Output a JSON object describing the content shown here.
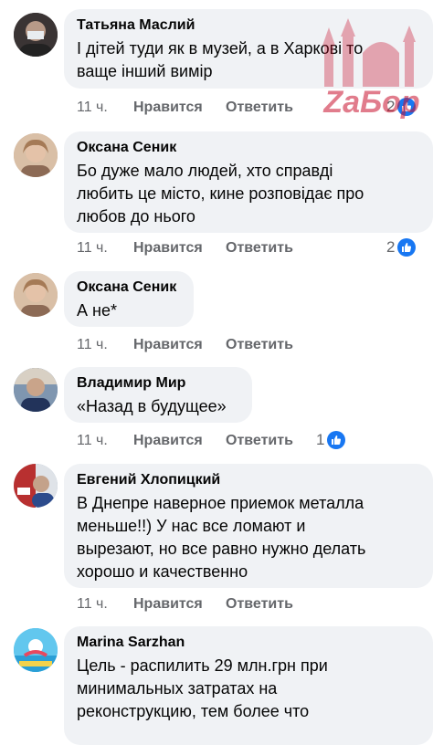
{
  "comments": [
    {
      "author": "Татьяна Маслий",
      "text": "І дітей туди як в музей, а в Харкові то\nваще інший вимір",
      "time": "11 ч.",
      "like": "Нравится",
      "reply": "Ответить",
      "reactions": "2",
      "avatar_color": "#4a4040"
    },
    {
      "author": "Оксана Сеник",
      "text": "Бо дуже мало людей, хто справді\nлюбить це місто, кине розповідає про\nлюбов до нього",
      "time": "11 ч.",
      "like": "Нравится",
      "reply": "Ответить",
      "reactions": "2",
      "avatar_color": "#c7a58c"
    },
    {
      "author": "Оксана Сеник",
      "text": "А не*",
      "time": "11 ч.",
      "like": "Нравится",
      "reply": "Ответить",
      "reactions": "",
      "avatar_color": "#c7a58c"
    },
    {
      "author": "Владимир Мир",
      "text": "«Назад в будущее»",
      "time": "11 ч.",
      "like": "Нравится",
      "reply": "Ответить",
      "reactions": "1",
      "avatar_color": "#5a7090"
    },
    {
      "author": "Евгений Хлопицкий",
      "text": "В Днепре наверное приемок металла\nменьше!!) У нас все ломают и\nвырезают, но все равно нужно делать\nхорошо и качественно",
      "time": "11 ч.",
      "like": "Нравится",
      "reply": "Ответить",
      "reactions": "",
      "avatar_color": "#8aa0b8"
    },
    {
      "author": "Marina Sarzhan",
      "text": "Цель - распилить 29 млн.грн при\nминимальных затратах на\nреконструкцию, тем более что",
      "time": "",
      "like": "",
      "reply": "",
      "reactions": "",
      "avatar_color": "#3cb6e6"
    }
  ],
  "watermark": {
    "text": "ZaБор",
    "color": "#c8102e"
  },
  "colors": {
    "bubble": "#f0f2f5",
    "meta": "#65676b",
    "like_badge": "#1877f2"
  }
}
